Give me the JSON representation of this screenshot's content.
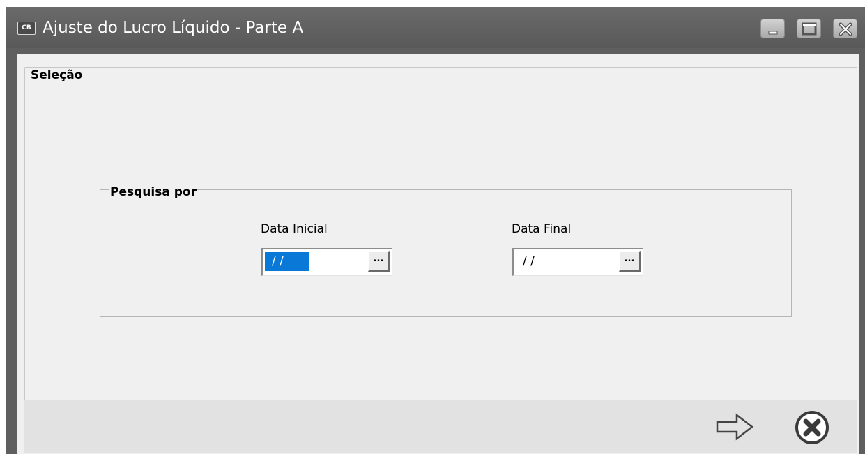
{
  "window": {
    "icon_text": "CB",
    "title": "Ajuste do Lucro Líquido - Parte A"
  },
  "selection": {
    "legend": "Seleção"
  },
  "search": {
    "legend": "Pesquisa por",
    "start_date": {
      "label": "Data Inicial",
      "value": "/ /",
      "button": "..."
    },
    "end_date": {
      "label": "Data Final",
      "value": "/ /",
      "button": "..."
    }
  },
  "actions": {
    "next_icon": "arrow-right-icon",
    "cancel_icon": "cancel-circle-icon"
  },
  "colors": {
    "titlebar": "#5f5f5f",
    "client_bg": "#f0f0f0",
    "selection_highlight": "#0a78d7"
  }
}
